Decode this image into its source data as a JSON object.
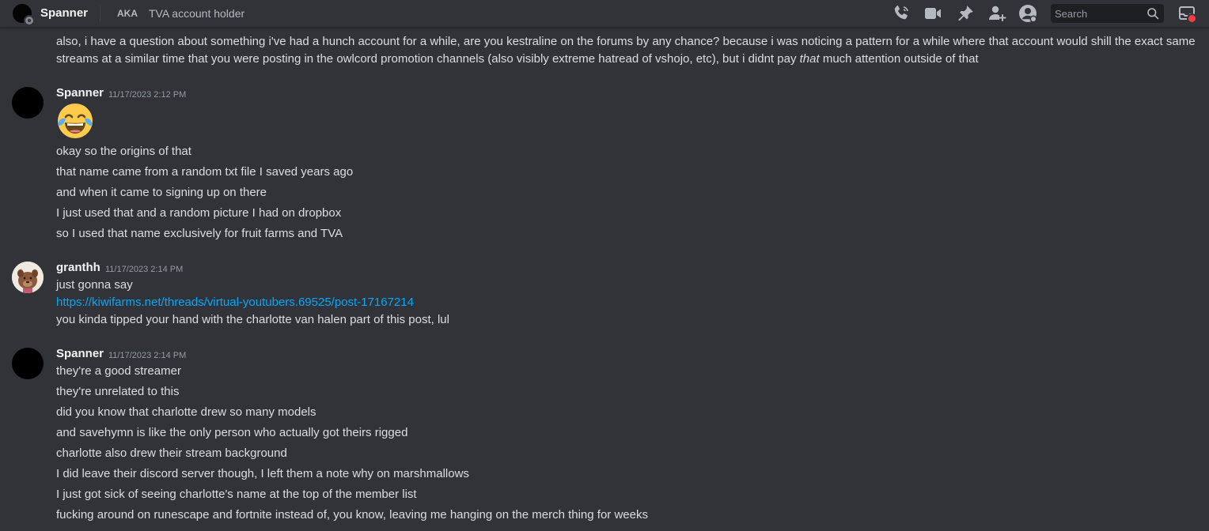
{
  "header": {
    "channel_name": "Spanner",
    "aka_label": "AKA",
    "nickname": "TVA account holder",
    "search_placeholder": "Search",
    "icons": [
      "voice-call-icon",
      "video-call-icon",
      "pinned-messages-icon",
      "add-friends-icon",
      "user-profile-icon",
      "inbox-icon"
    ]
  },
  "colors": {
    "background": "#313338",
    "link": "#00a8fc",
    "username": "#f2f3f5",
    "timestamp": "#949ba4",
    "unread_dot": "#f23f43"
  },
  "messages": {
    "prev": {
      "lines": [
        "also, i have a question about something i've had a hunch account for a while, are you kestraline on the forums by any chance? because i was noticing a pattern for a while where that account would shill the exact same",
        "streams at a similar time that you were posting in the owlcord promotion channels (also visibly extreme hatread of vshojo, etc), but i didnt pay",
        "that",
        "much attention outside of that"
      ]
    },
    "m1": {
      "author": "Spanner",
      "timestamp": "11/17/2023 2:12 PM",
      "emoji": "joy-emoji",
      "lines": [
        "okay so the origins of that",
        "that name came from a random txt file I saved years ago",
        "and when it came to signing up on there",
        "I just used that and a random picture I had on dropbox",
        "so I used that name exclusively for fruit farms and TVA"
      ]
    },
    "m2": {
      "author": "granthh",
      "timestamp": "11/17/2023 2:14 PM",
      "lines": [
        "just gonna say",
        "https://kiwifarms.net/threads/virtual-youtubers.69525/post-17167214",
        "you kinda tipped your hand with the charlotte van halen part of this post, lul"
      ]
    },
    "m3": {
      "author": "Spanner",
      "timestamp": "11/17/2023 2:14 PM",
      "lines": [
        "they're a good streamer",
        "they're unrelated to this",
        "did you know that charlotte drew so many models",
        "and savehymn is like the only person who actually got theirs rigged",
        "charlotte also drew their stream background",
        "I did leave their discord server though, I left them a note why on marshmallows",
        "I just got sick of seeing charlotte's name at the top of the member list",
        "fucking around on runescape and fortnite instead of, you know, leaving me hanging on the merch thing for weeks"
      ]
    }
  }
}
